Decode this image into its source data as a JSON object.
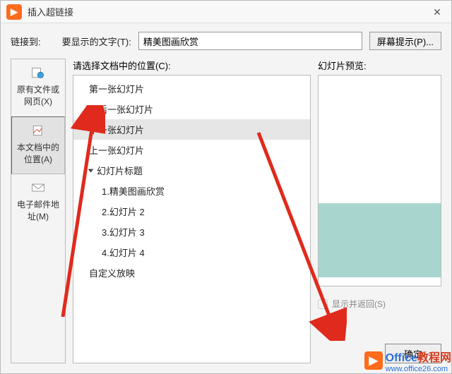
{
  "window": {
    "title": "插入超链接"
  },
  "top": {
    "link_to": "链接到:",
    "display_label": "要显示的文字(T):",
    "display_value": "精美图画欣赏",
    "screentip_btn": "屏幕提示(P)..."
  },
  "sidebar": {
    "items": [
      {
        "label": "原有文件或网页(X)"
      },
      {
        "label": "本文档中的位置(A)"
      },
      {
        "label": "电子邮件地址(M)"
      }
    ]
  },
  "center": {
    "label": "请选择文档中的位置(C):",
    "items": [
      {
        "text": "第一张幻灯片",
        "indent": 0
      },
      {
        "text": "最后一张幻灯片",
        "indent": 0
      },
      {
        "text": "下一张幻灯片",
        "indent": 0,
        "selected": true
      },
      {
        "text": "上一张幻灯片",
        "indent": 0
      },
      {
        "text": "幻灯片标题",
        "indent": 0,
        "expandable": true
      },
      {
        "text": "1.精美图画欣赏",
        "indent": 1
      },
      {
        "text": "2.幻灯片 2",
        "indent": 1
      },
      {
        "text": "3.幻灯片 3",
        "indent": 1
      },
      {
        "text": "4.幻灯片 4",
        "indent": 1
      },
      {
        "text": "自定义放映",
        "indent": 0
      }
    ]
  },
  "right": {
    "preview_label": "幻灯片预览:",
    "show_and_return": "显示并返回(S)",
    "ok_button": "确定"
  },
  "watermark": {
    "brand1": "Office",
    "brand2": "教程网",
    "url": "www.office26.com"
  }
}
